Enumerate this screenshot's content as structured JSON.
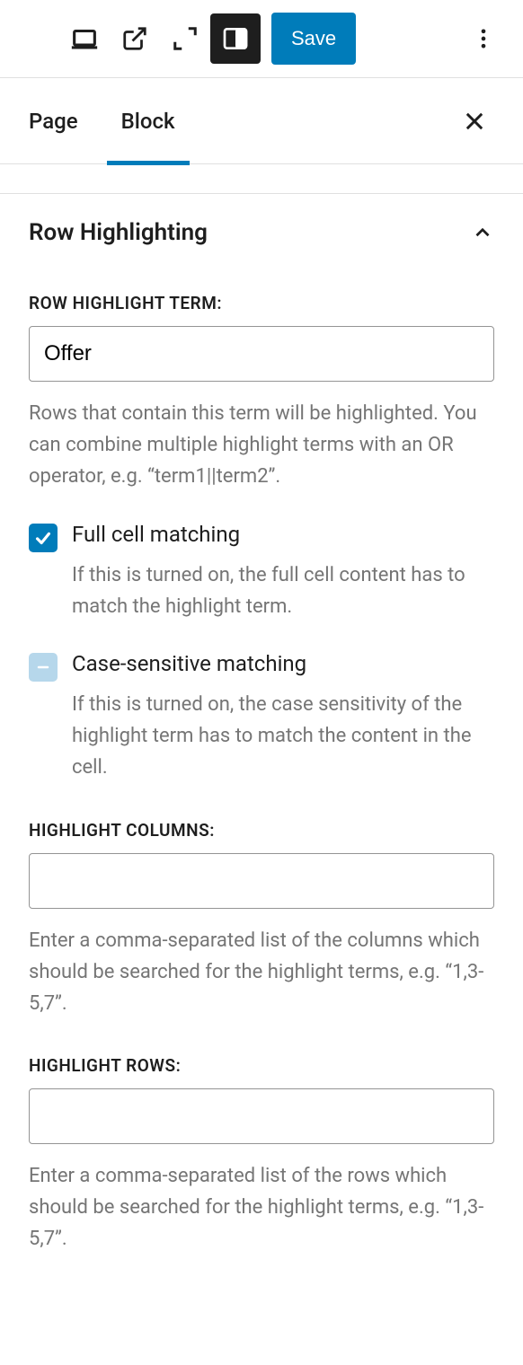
{
  "toolbar": {
    "save_label": "Save"
  },
  "tabs": {
    "page": "Page",
    "block": "Block",
    "active": "block"
  },
  "panel": {
    "title": "Row Highlighting",
    "expanded": true
  },
  "highlight_term": {
    "label": "ROW HIGHLIGHT TERM:",
    "value": "Offer",
    "help": "Rows that contain this term will be highlighted. You can combine multiple highlight terms with an OR operator, e.g. “term1||term2”."
  },
  "full_cell": {
    "label": "Full cell matching",
    "checked": true,
    "help": "If this is turned on, the full cell content has to match the highlight term."
  },
  "case_sensitive": {
    "label": "Case-sensitive matching",
    "state": "indeterminate",
    "help": "If this is turned on, the case sensitivity of the highlight term has to match the content in the cell."
  },
  "highlight_columns": {
    "label": "HIGHLIGHT COLUMNS:",
    "value": "",
    "help": "Enter a comma-separated list of the columns which should be searched for the highlight terms, e.g. “1,3-5,7”."
  },
  "highlight_rows": {
    "label": "HIGHLIGHT ROWS:",
    "value": "",
    "help": "Enter a comma-separated list of the rows which should be searched for the highlight terms, e.g. “1,3-5,7”."
  }
}
